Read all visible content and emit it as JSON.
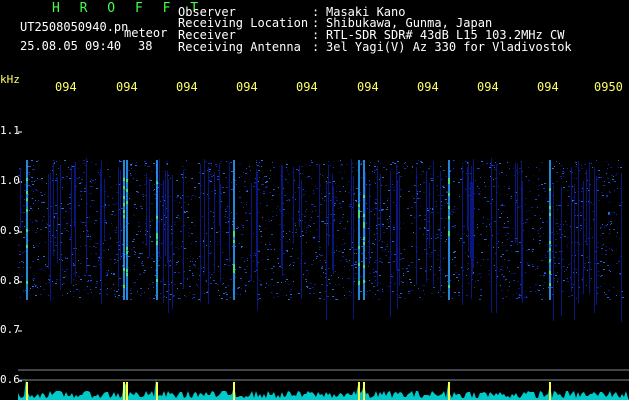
{
  "header": {
    "app_title": "H R O F F T",
    "filename": "UT2508050940.pn",
    "tag": "meteor",
    "datetime": "25.08.05 09:40",
    "count": "38"
  },
  "info": [
    {
      "label": "Observer",
      "sep": ":",
      "value": "Masaki Kano"
    },
    {
      "label": "Receiving Location",
      "sep": ":",
      "value": "Shibukawa, Gunma, Japan"
    },
    {
      "label": "Receiver",
      "sep": ":",
      "value": "RTL-SDR SDR# 43dB L15 103.2MHz CW"
    },
    {
      "label": "Receiving Antenna",
      "sep": ":",
      "value": "3el Yagi(V) Az 330 for Vladivostok"
    }
  ],
  "axis": {
    "unit": "kHz",
    "time_ticks": [
      "094",
      "094",
      "094",
      "094",
      "094",
      "094",
      "094",
      "094",
      "094",
      "0950"
    ],
    "freq_ticks": [
      "1.1",
      "1.0",
      "0.9",
      "0.8",
      "0.7",
      "0.6"
    ]
  },
  "colors": {
    "background": "#000000",
    "title": "#44ff44",
    "ticks": "#ffff66",
    "text": "#ffffff",
    "signal_low": "#0a1a8a",
    "signal_mid": "#2aa0ff",
    "signal_high": "#ffff44",
    "baseline": "#00e0e0"
  }
}
